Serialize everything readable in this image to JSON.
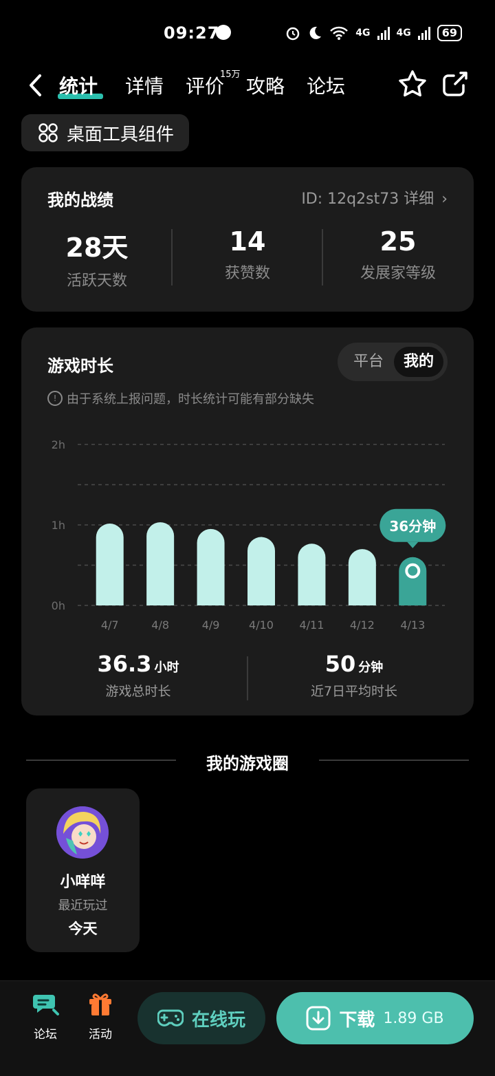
{
  "status_bar": {
    "time": "09:27",
    "net1": "4G",
    "net2": "4G",
    "battery": "69"
  },
  "nav": {
    "tabs": [
      {
        "label": "统计",
        "active": true
      },
      {
        "label": "详情"
      },
      {
        "label": "评价"
      },
      {
        "label": "攻略"
      },
      {
        "label": "论坛"
      }
    ],
    "review_badge": "15万",
    "icons": [
      "back-icon",
      "star-icon",
      "share-icon"
    ]
  },
  "widget_button": {
    "label": "桌面工具组件",
    "icon": "grid-icon"
  },
  "record": {
    "title": "我的战绩",
    "id_link": "ID: 12q2st73 详细",
    "stats": [
      {
        "value": "28天",
        "label": "活跃天数"
      },
      {
        "value": "14",
        "label": "获赞数"
      },
      {
        "value": "25",
        "label": "发展家等级"
      }
    ]
  },
  "playtime": {
    "title": "游戏时长",
    "toggle": {
      "options": [
        "平台",
        "我的"
      ],
      "selected": "我的"
    },
    "notice": "由于系统上报问题，时长统计可能有部分缺失",
    "tooltip": "36分钟",
    "total": {
      "value": "36.3",
      "unit": "小时",
      "label": "游戏总时长"
    },
    "average": {
      "value": "50",
      "unit": "分钟",
      "label": "近7日平均时长"
    },
    "colors": {
      "bar": "#c2f0ea",
      "highlight": "#3aa597"
    }
  },
  "chart_data": {
    "type": "bar",
    "categories": [
      "4/7",
      "4/8",
      "4/9",
      "4/10",
      "4/11",
      "4/12",
      "4/13"
    ],
    "values": [
      61,
      62,
      57,
      51,
      46,
      42,
      36
    ],
    "y_unit": "minutes",
    "yticks": [
      "0h",
      "1h",
      "2h"
    ],
    "ylim": [
      0,
      120
    ],
    "grid": true,
    "highlight_index": 6
  },
  "game_circle": {
    "section_title": "我的游戏圈",
    "card": {
      "name": "小咩咩",
      "subtitle": "最近玩过",
      "when": "今天"
    }
  },
  "bottom_bar": {
    "forum_label": "论坛",
    "activity_label": "活动",
    "online_label": "在线玩",
    "download_label": "下载",
    "download_size": "1.89 GB"
  }
}
